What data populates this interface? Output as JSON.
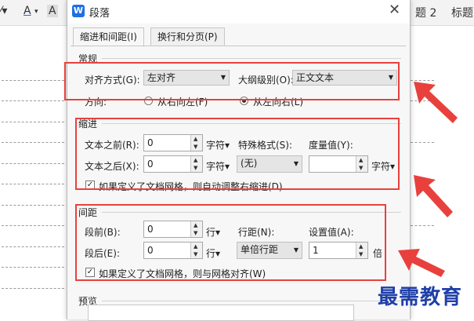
{
  "editor": {
    "toolbar_a": "A",
    "toolbar_a2": "A",
    "heading2": "题 2",
    "heading": "标题"
  },
  "dialog": {
    "app_icon": "W",
    "title": "段落",
    "close": "✕",
    "tabs": [
      "缩进和间距(I)",
      "换行和分页(P)"
    ],
    "general": {
      "label": "常规",
      "align_label": "对齐方式(G):",
      "align_value": "左对齐",
      "outline_label": "大纲级别(O):",
      "outline_value": "正文文本",
      "direction_label": "方向:",
      "rtl_label": "从右向左(F)",
      "ltr_label": "从左向右(L)"
    },
    "indent": {
      "label": "缩进",
      "before_label": "文本之前(R):",
      "before_value": "0",
      "before_unit": "字符▾",
      "special_label": "特殊格式(S):",
      "measure_label": "度量值(Y):",
      "after_label": "文本之后(X):",
      "after_value": "0",
      "after_unit": "字符▾",
      "special_value": "(无)",
      "measure_value": "",
      "measure_unit": "字符▾",
      "auto_adjust": "如果定义了文档网格，则自动调整右缩进(D)"
    },
    "spacing": {
      "label": "间距",
      "before_label": "段前(B):",
      "before_value": "0",
      "before_unit": "行▾",
      "line_label": "行距(N):",
      "setting_label": "设置值(A):",
      "after_label": "段后(E):",
      "after_value": "0",
      "after_unit": "行▾",
      "line_value": "单倍行距",
      "setting_value": "1",
      "setting_unit": "倍",
      "snap_grid": "如果定义了文档网格，则与网格对齐(W)"
    },
    "preview": {
      "label": "预览"
    }
  },
  "watermark": "最需教育",
  "colors": {
    "highlight": "#e8413d",
    "watermark": "#1f3fa8"
  }
}
